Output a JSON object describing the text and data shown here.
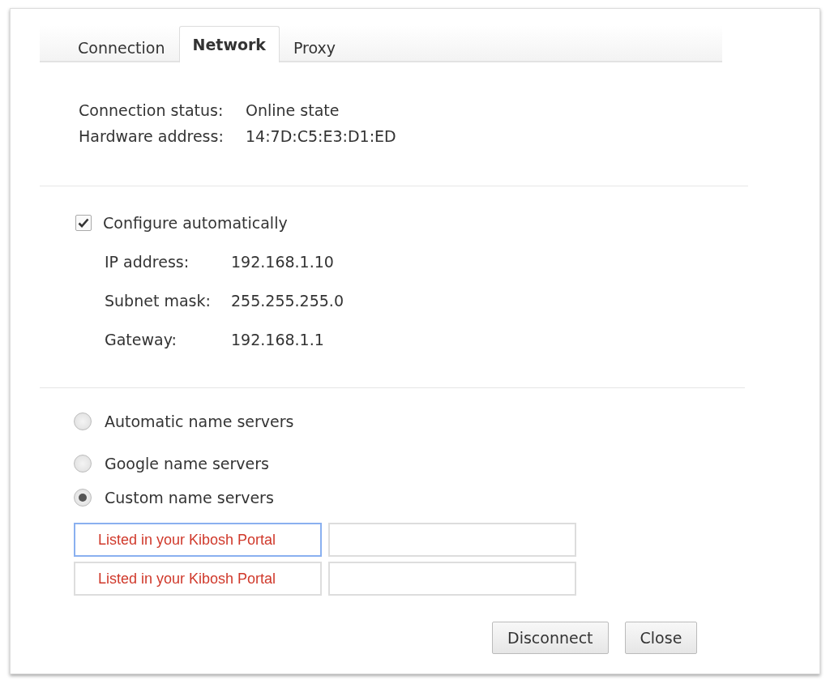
{
  "tabs": [
    {
      "label": "Connection",
      "selected": false
    },
    {
      "label": "Network",
      "selected": true
    },
    {
      "label": "Proxy",
      "selected": false
    }
  ],
  "status": [
    {
      "label": "Connection status:",
      "value": "Online state"
    },
    {
      "label": "Hardware address:",
      "value": "14:7D:C5:E3:D1:ED"
    }
  ],
  "auto_config": {
    "label": "Configure automatically",
    "checked": true
  },
  "ip_settings": [
    {
      "label": "IP address:",
      "value": "192.168.1.10"
    },
    {
      "label": "Subnet mask:",
      "value": "255.255.255.0"
    },
    {
      "label": "Gateway:",
      "value": "192.168.1.1"
    }
  ],
  "name_servers": [
    {
      "label": "Automatic name servers",
      "selected": false
    },
    {
      "label": "Google name servers",
      "selected": false
    },
    {
      "label": "Custom name servers",
      "selected": true
    }
  ],
  "custom_servers": [
    [
      {
        "value": "Listed in your Kibosh Portal",
        "focused": true
      },
      {
        "focused": false
      }
    ],
    [
      {
        "value": "Listed in your Kibosh Portal",
        "focused": false
      },
      {
        "focused": false
      }
    ]
  ],
  "buttons": [
    "Disconnect",
    "Close"
  ]
}
